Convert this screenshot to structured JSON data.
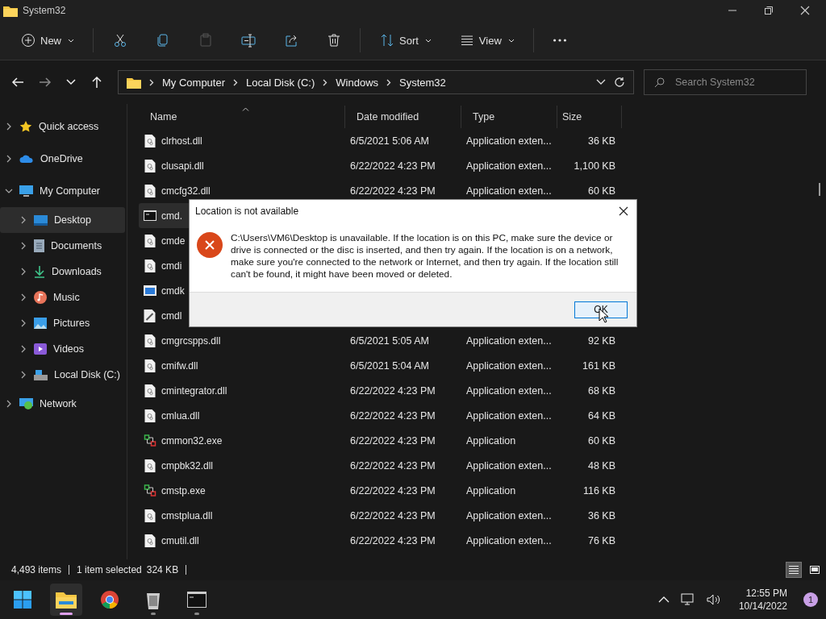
{
  "window": {
    "title": "System32"
  },
  "toolbar": [
    {
      "kind": "new",
      "label": "New",
      "disabled": false
    },
    {
      "kind": "cut",
      "disabled": false
    },
    {
      "kind": "copy",
      "disabled": false
    },
    {
      "kind": "paste",
      "disabled": true
    },
    {
      "kind": "rename",
      "disabled": false
    },
    {
      "kind": "share",
      "disabled": false
    },
    {
      "kind": "delete",
      "disabled": false
    },
    {
      "kind": "sort",
      "label": "Sort",
      "disabled": false
    },
    {
      "kind": "view",
      "label": "View",
      "disabled": false
    },
    {
      "kind": "more",
      "disabled": false
    }
  ],
  "navigation": {
    "back_disabled": false,
    "forward_disabled": true
  },
  "address": {
    "breadcrumbs": [
      "My Computer",
      "Local Disk (C:)",
      "Windows",
      "System32"
    ]
  },
  "search": {
    "placeholder": "Search System32"
  },
  "sidebar": {
    "items": [
      {
        "label": "Quick access",
        "kind": "star",
        "expanded": false,
        "selected": false
      },
      {
        "label": "OneDrive",
        "kind": "cloud",
        "expanded": false,
        "selected": false
      },
      {
        "label": "My Computer",
        "kind": "computer",
        "expanded": true,
        "selected": false,
        "children": [
          {
            "label": "Desktop",
            "kind": "desktop",
            "expanded": false,
            "selected": true
          },
          {
            "label": "Documents",
            "kind": "documents",
            "expanded": false,
            "selected": false
          },
          {
            "label": "Downloads",
            "kind": "downloads",
            "expanded": false,
            "selected": false
          },
          {
            "label": "Music",
            "kind": "music",
            "expanded": false,
            "selected": false
          },
          {
            "label": "Pictures",
            "kind": "pictures",
            "expanded": false,
            "selected": false
          },
          {
            "label": "Videos",
            "kind": "videos",
            "expanded": false,
            "selected": false
          },
          {
            "label": "Local Disk (C:)",
            "kind": "disk",
            "expanded": false,
            "selected": false
          }
        ]
      },
      {
        "label": "Network",
        "kind": "network",
        "expanded": false,
        "selected": false
      }
    ]
  },
  "table": {
    "columns": [
      {
        "label": "Name",
        "sorted": true
      },
      {
        "label": "Date modified",
        "sorted": false
      },
      {
        "label": "Type",
        "sorted": false
      },
      {
        "label": "Size",
        "sorted": false
      }
    ],
    "rows": [
      {
        "name": "clrhost.dll",
        "date": "6/5/2021 5:06 AM",
        "type": "Application exten...",
        "size": "36 KB",
        "kind": "dll",
        "selected": false
      },
      {
        "name": "clusapi.dll",
        "date": "6/22/2022 4:23 PM",
        "type": "Application exten...",
        "size": "1,100 KB",
        "kind": "dll",
        "selected": false
      },
      {
        "name": "cmcfg32.dll",
        "date": "6/22/2022 4:23 PM",
        "type": "Application exten...",
        "size": "60 KB",
        "kind": "dll",
        "selected": false
      },
      {
        "name": "cmd.",
        "kind": "console",
        "selected": true
      },
      {
        "name": "cmde",
        "kind": "dll",
        "selected": false
      },
      {
        "name": "cmdi",
        "kind": "dll",
        "selected": false
      },
      {
        "name": "cmdk",
        "kind": "window",
        "selected": false
      },
      {
        "name": "cmdl",
        "kind": "tool",
        "selected": false
      },
      {
        "name": "cmgrcspps.dll",
        "date": "6/5/2021 5:05 AM",
        "type": "Application exten...",
        "size": "92 KB",
        "kind": "dll",
        "selected": false
      },
      {
        "name": "cmifw.dll",
        "date": "6/5/2021 5:04 AM",
        "type": "Application exten...",
        "size": "161 KB",
        "kind": "dll",
        "selected": false
      },
      {
        "name": "cmintegrator.dll",
        "date": "6/22/2022 4:23 PM",
        "type": "Application exten...",
        "size": "68 KB",
        "kind": "dll",
        "selected": false
      },
      {
        "name": "cmlua.dll",
        "date": "6/22/2022 4:23 PM",
        "type": "Application exten...",
        "size": "64 KB",
        "kind": "dll",
        "selected": false
      },
      {
        "name": "cmmon32.exe",
        "date": "6/22/2022 4:23 PM",
        "type": "Application",
        "size": "60 KB",
        "kind": "exe",
        "selected": false
      },
      {
        "name": "cmpbk32.dll",
        "date": "6/22/2022 4:23 PM",
        "type": "Application exten...",
        "size": "48 KB",
        "kind": "dll",
        "selected": false
      },
      {
        "name": "cmstp.exe",
        "date": "6/22/2022 4:23 PM",
        "type": "Application",
        "size": "116 KB",
        "kind": "exe",
        "selected": false
      },
      {
        "name": "cmstplua.dll",
        "date": "6/22/2022 4:23 PM",
        "type": "Application exten...",
        "size": "36 KB",
        "kind": "dll",
        "selected": false
      },
      {
        "name": "cmutil.dll",
        "date": "6/22/2022 4:23 PM",
        "type": "Application exten...",
        "size": "76 KB",
        "kind": "dll",
        "selected": false
      }
    ]
  },
  "dialog": {
    "title": "Location is not available",
    "message": "C:\\Users\\VM6\\Desktop is unavailable. If the location is on this PC, make sure the device or drive is connected or the disc is inserted, and then try again. If the location is on a network, make sure you're connected to the network or Internet, and then try again. If the location still can't be found, it might have been moved or deleted.",
    "button": "OK",
    "button_focused": true
  },
  "status_bar": {
    "item_count": "4,493 items",
    "selection": "1 item selected",
    "selection_size": "324 KB",
    "views": [
      {
        "kind": "details",
        "selected": true
      },
      {
        "kind": "tiles",
        "selected": false
      }
    ]
  },
  "taskbar": {
    "apps": [
      {
        "kind": "start",
        "active": false,
        "running": false
      },
      {
        "kind": "explorer",
        "active": true,
        "running": true
      },
      {
        "kind": "browser",
        "active": false,
        "running": false
      },
      {
        "kind": "recycle",
        "active": false,
        "running": true
      },
      {
        "kind": "terminal",
        "active": false,
        "running": true
      }
    ],
    "time": "12:55 PM",
    "date": "10/14/2022",
    "notifications": "1"
  }
}
